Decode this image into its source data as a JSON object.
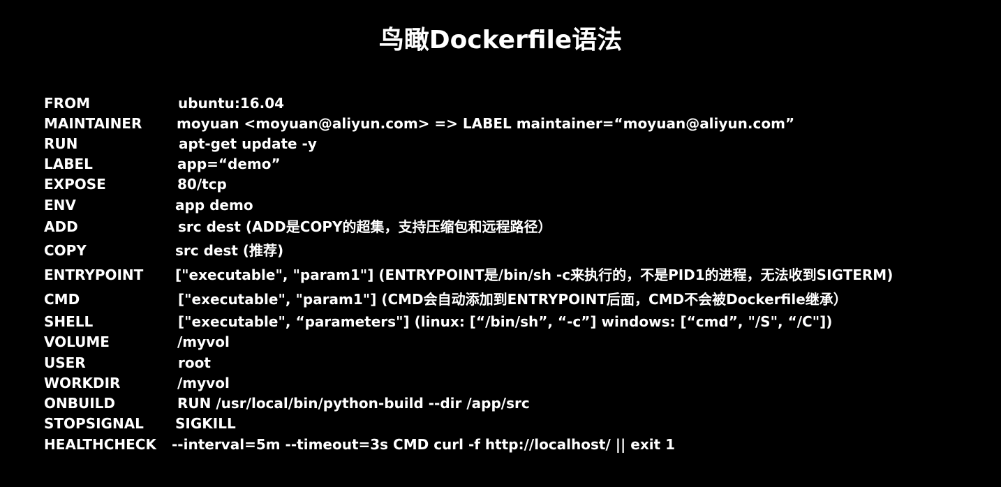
{
  "title": "鸟瞰Dockerfile语法",
  "rows": [
    {
      "keyword": "FROM",
      "value": "ubuntu:16.04"
    },
    {
      "keyword": "MAINTAINER",
      "value": "moyuan <moyuan@aliyun.com>  => LABEL maintainer=“moyuan@aliyun.com”"
    },
    {
      "keyword": "RUN",
      "value": "apt-get update -y"
    },
    {
      "keyword": "LABEL",
      "value": "app=“demo”"
    },
    {
      "keyword": "EXPOSE",
      "value": "80/tcp"
    },
    {
      "keyword": "ENV",
      "value": "app demo"
    },
    {
      "keyword": "ADD",
      "value": "src dest   (ADD是COPY的超集，支持压缩包和远程路径）"
    },
    {
      "keyword": "COPY",
      "value": "src dest  (推荐)"
    },
    {
      "keyword": "ENTRYPOINT",
      "value": "[\"executable\", \"param1\"] (ENTRYPOINT是/bin/sh -c来执行的，不是PID1的进程，无法收到SIGTERM)"
    },
    {
      "keyword": "CMD",
      "value": "[\"executable\", \"param1\"] (CMD会自动添加到ENTRYPOINT后面，CMD不会被Dockerfile继承）"
    },
    {
      "keyword": "SHELL",
      "value": "[\"executable\", “parameters\"] (linux: [“/bin/sh”, “-c”] windows: [“cmd”, \"/S\", “/C\"])"
    },
    {
      "keyword": "VOLUME",
      "value": "/myvol"
    },
    {
      "keyword": "USER",
      "value": "root"
    },
    {
      "keyword": "WORKDIR",
      "value": "/myvol"
    },
    {
      "keyword": "ONBUILD",
      "value": "RUN /usr/local/bin/python-build --dir /app/src"
    },
    {
      "keyword": "STOPSIGNAL",
      "value": "SIGKILL"
    },
    {
      "keyword": "HEALTHCHECK",
      "value": " --interval=5m --timeout=3s CMD curl -f http://localhost/ || exit 1"
    }
  ]
}
